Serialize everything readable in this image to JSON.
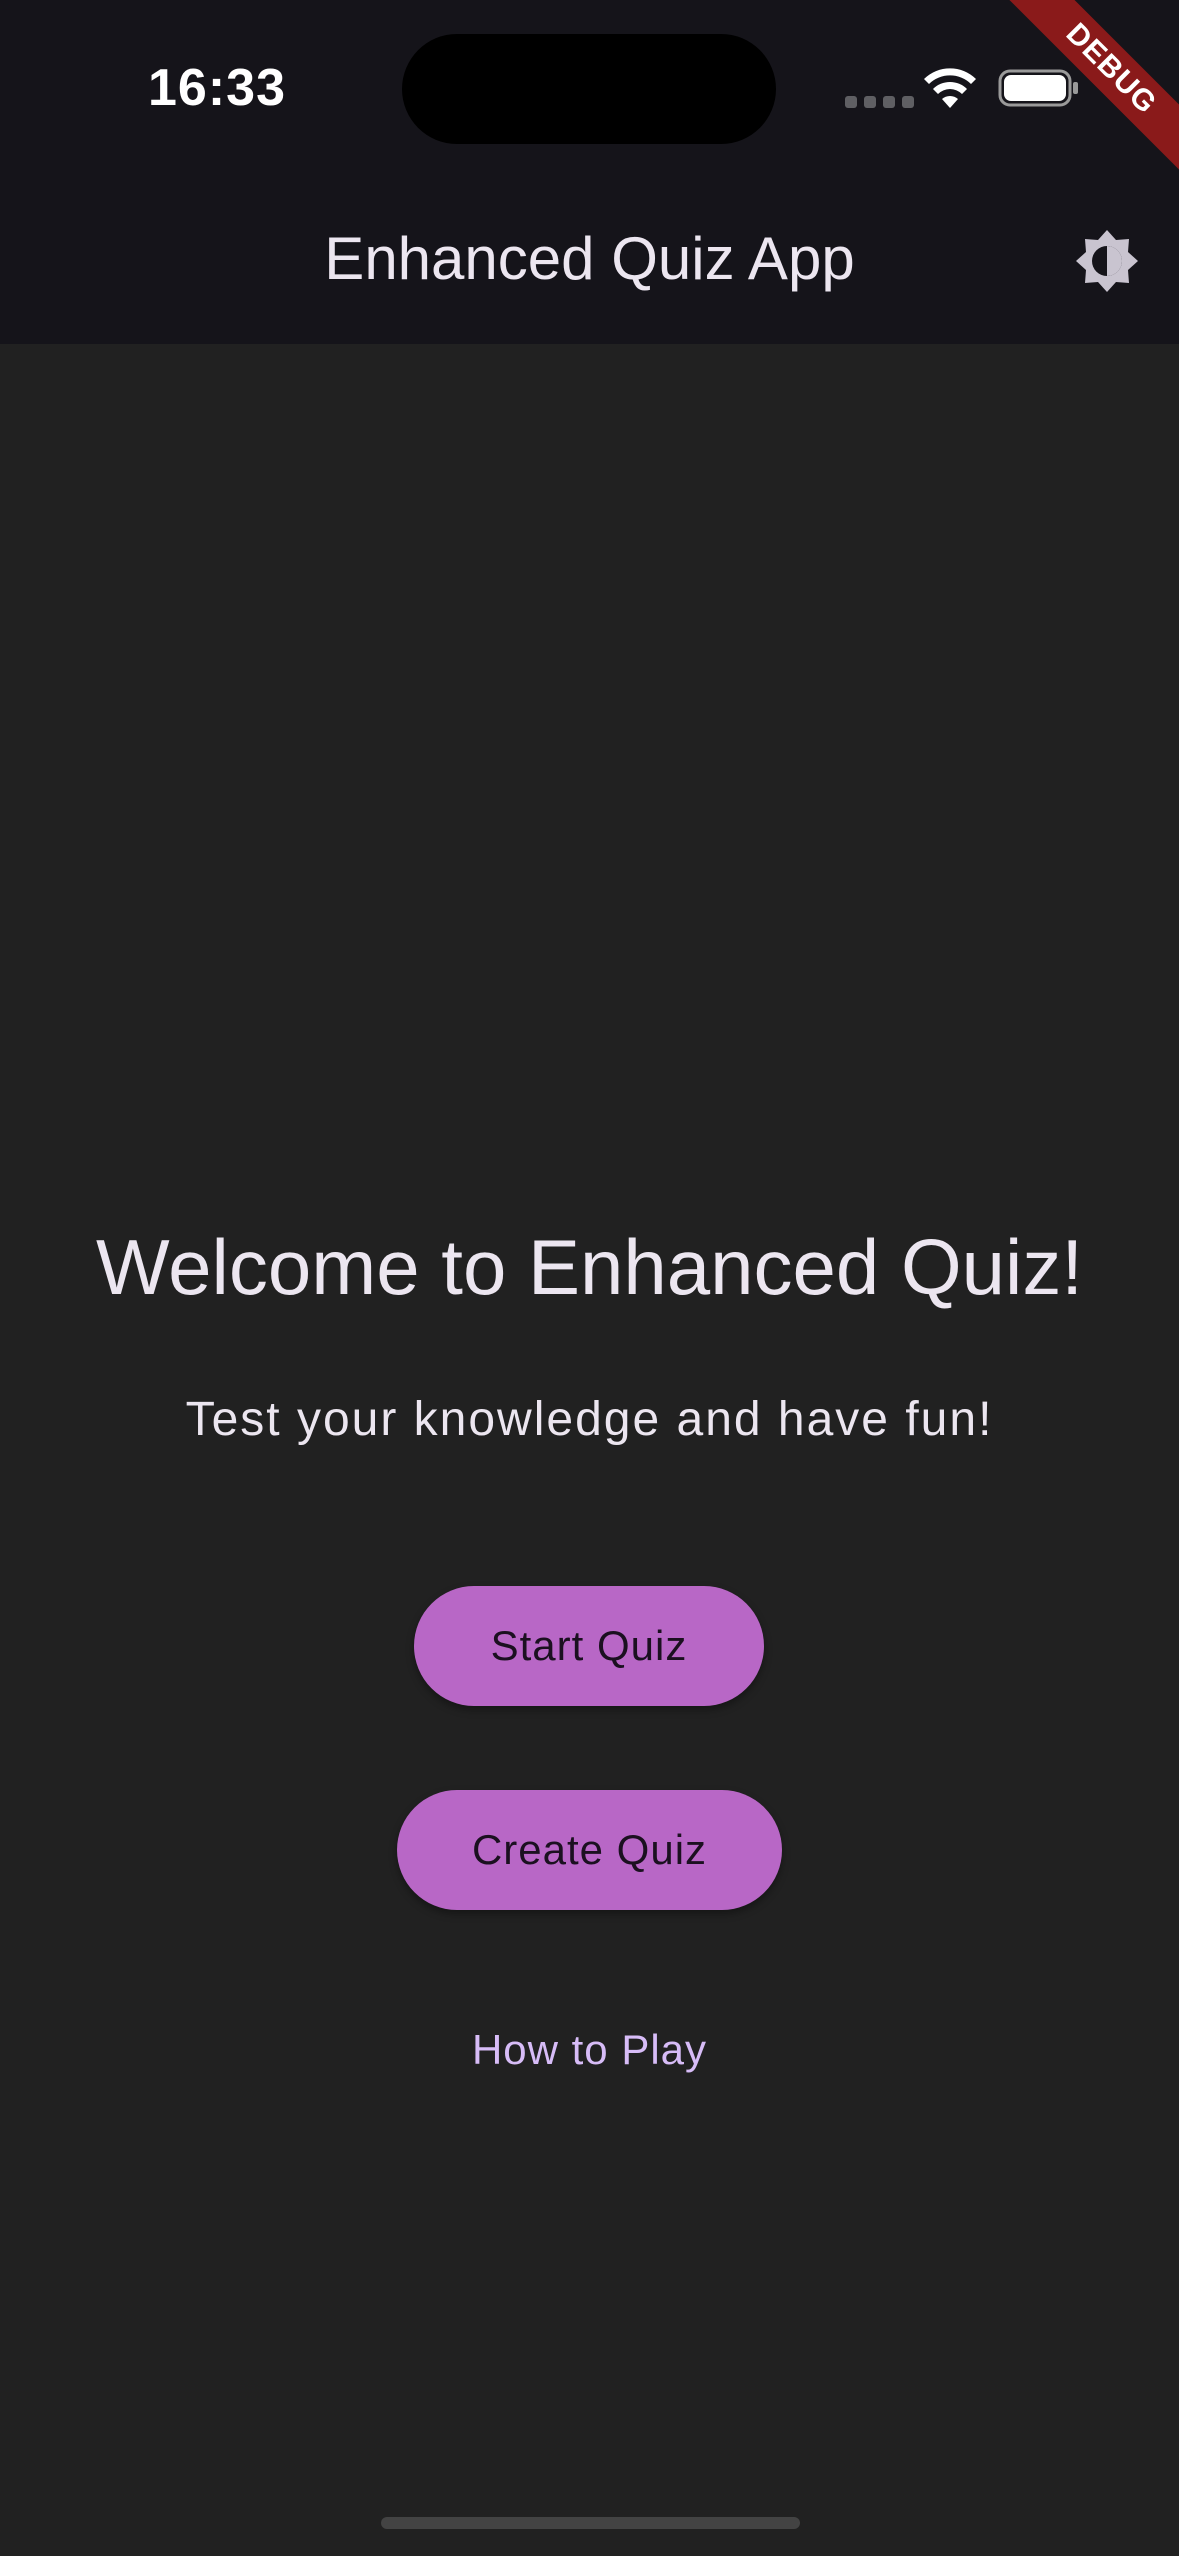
{
  "status_bar": {
    "time": "16:33",
    "wifi_icon": "wifi-icon",
    "battery_icon": "battery-icon"
  },
  "debug_banner": {
    "label": "DEBUG",
    "color": "#8a1a1a"
  },
  "app_bar": {
    "title": "Enhanced Quiz App",
    "theme_toggle_icon": "brightness-icon"
  },
  "main": {
    "welcome_title": "Welcome to Enhanced Quiz!",
    "subtitle": "Test your knowledge and have fun!",
    "start_button_label": "Start Quiz",
    "create_button_label": "Create Quiz",
    "how_to_play_label": "How to Play"
  },
  "colors": {
    "background": "#212121",
    "app_bar": "#15141a",
    "button": "#b867c6",
    "link": "#d7bcf7",
    "text": "#ece6f0"
  }
}
